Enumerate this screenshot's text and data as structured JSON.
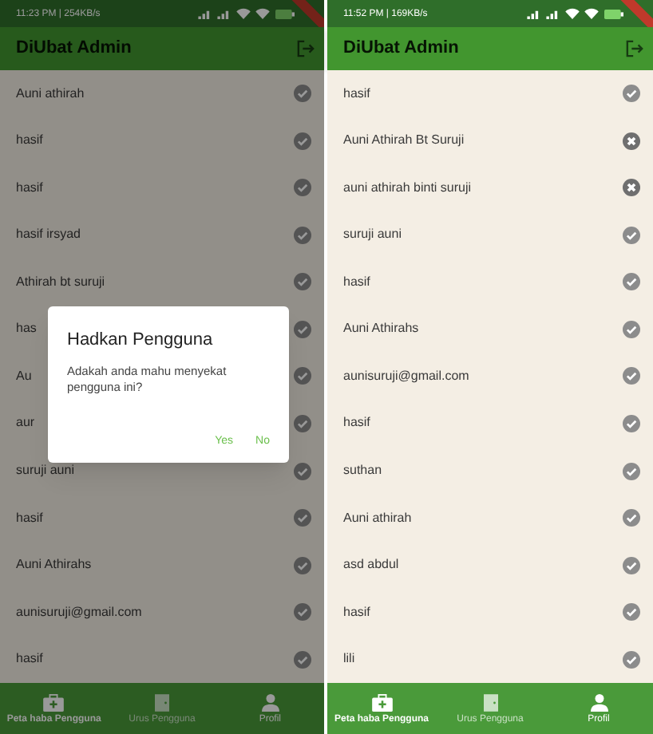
{
  "phones": [
    {
      "status_bar": {
        "time": "11:23 PM | 254KB/s"
      },
      "app_bar": {
        "title": "DiUbat Admin"
      },
      "users": [
        {
          "name": "Auni athirah",
          "active": true
        },
        {
          "name": "hasif",
          "active": true
        },
        {
          "name": "hasif",
          "active": true
        },
        {
          "name": "hasif irsyad",
          "active": true
        },
        {
          "name": "Athirah bt suruji",
          "active": true
        },
        {
          "name": "has",
          "active": true
        },
        {
          "name": "Au",
          "active": true
        },
        {
          "name": "aur",
          "active": true
        },
        {
          "name": "suruji auni",
          "active": true
        },
        {
          "name": "hasif",
          "active": true
        },
        {
          "name": "Auni Athirahs",
          "active": true
        },
        {
          "name": "aunisuruji@gmail.com",
          "active": true
        },
        {
          "name": "hasif",
          "active": true
        }
      ],
      "dialog": {
        "title": "Hadkan Pengguna",
        "message": "Adakah anda mahu menyekat pengguna ini?",
        "buttons": [
          "Yes",
          "No"
        ]
      },
      "nav": [
        {
          "label": "Peta haba Pengguna",
          "selected": true,
          "disabled": false
        },
        {
          "label": "Urus Pengguna",
          "selected": false,
          "disabled": true
        },
        {
          "label": "Profil",
          "selected": false,
          "disabled": false
        }
      ]
    },
    {
      "status_bar": {
        "time": "11:52 PM | 169KB/s"
      },
      "app_bar": {
        "title": "DiUbat Admin"
      },
      "users": [
        {
          "name": "hasif",
          "active": true
        },
        {
          "name": "Auni Athirah Bt Suruji",
          "active": false
        },
        {
          "name": "auni athirah binti suruji",
          "active": false
        },
        {
          "name": "suruji auni",
          "active": true
        },
        {
          "name": "hasif",
          "active": true
        },
        {
          "name": "Auni Athirahs",
          "active": true
        },
        {
          "name": "aunisuruji@gmail.com",
          "active": true
        },
        {
          "name": "hasif",
          "active": true
        },
        {
          "name": "suthan",
          "active": true
        },
        {
          "name": "Auni athirah",
          "active": true
        },
        {
          "name": "asd abdul",
          "active": true
        },
        {
          "name": "hasif",
          "active": true
        },
        {
          "name": "lili",
          "active": true
        }
      ],
      "nav": [
        {
          "label": "Peta haba Pengguna",
          "selected": true,
          "disabled": false
        },
        {
          "label": "Urus Pengguna",
          "selected": false,
          "disabled": true
        },
        {
          "label": "Profil",
          "selected": false,
          "disabled": false
        }
      ]
    }
  ]
}
